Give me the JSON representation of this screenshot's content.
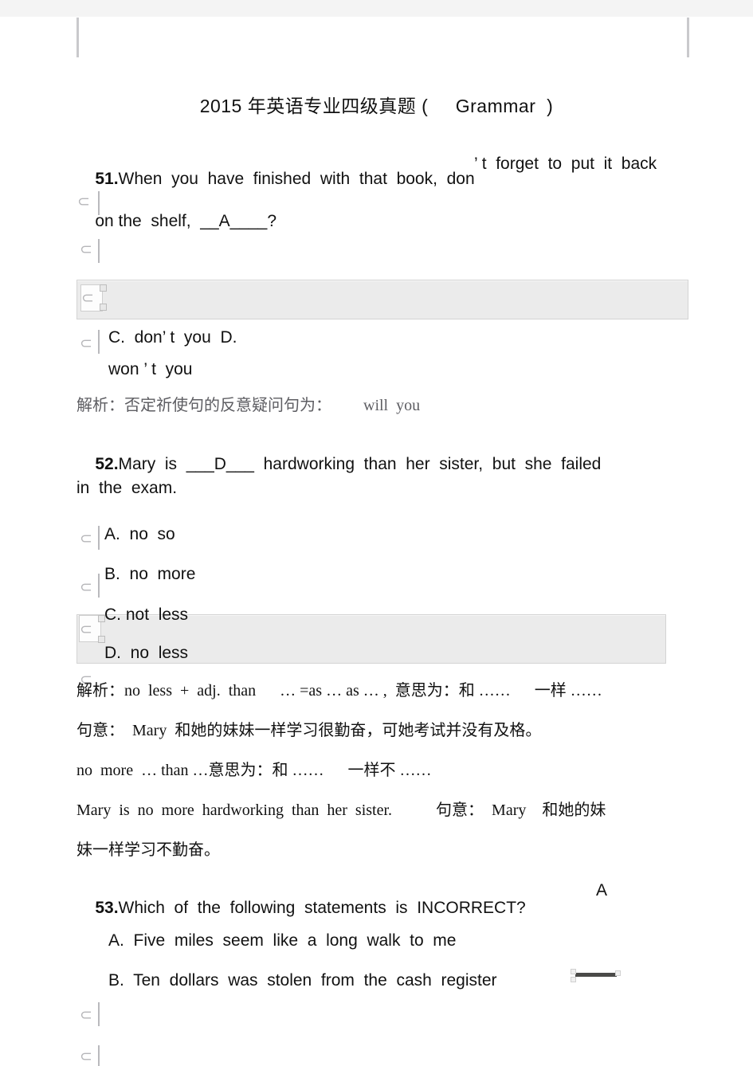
{
  "document": {
    "title": "2015 年英语专业四级真题 (     Grammar  )"
  },
  "questions": [
    {
      "number": "51.",
      "text_line1": "When  you  have  finished  with  that  book,  don",
      "text_line1_right": "’ t  forget  to  put  it  back",
      "text_line2": "on",
      "text_line2_rest": " the  shelf,  __A____?",
      "options": [
        {
          "label": ""
        },
        {
          "label": ""
        },
        {
          "label": "C.  don’ t  you  D."
        },
        {
          "label": "won ’ t  you"
        }
      ],
      "analysis": "解析：否定祈使句的反意疑问句为：        will  you"
    },
    {
      "number": "52.",
      "text_line1": "Mary  is  ___D___  hardworking  than  her  sister,  but  she  failed",
      "text_line2": "in  the  exam.",
      "options": [
        {
          "label": "A.  no  so"
        },
        {
          "label": "B.  no  more"
        },
        {
          "label": "C. not  less"
        },
        {
          "label": "D.  no  less"
        }
      ],
      "analysis_lines": [
        "解析：no  less  +  adj.  than      … =as … as … ,  意思为：和 ……      一样 ……",
        "句意：  Mary  和她的妹妹一样学习很勤奋，可她考试并没有及格。",
        "no  more  … than …意思为：和 ……      一样不 ……",
        "Mary  is  no  more  hardworking  than  her  sister.           句意：  Mary    和她的妹",
        "妹一样学习不勤奋。"
      ]
    },
    {
      "number": "53.",
      "text_line1": "Which  of  the  following  statements  is  INCORRECT?",
      "answer": "A",
      "options": [
        {
          "label": "A.  Five  miles  seem  like  a  long  walk  to  me"
        },
        {
          "label": "B.  Ten  dollars  was  stolen  from  the  cash  register"
        },
        {
          "label": ""
        },
        {
          "label": ""
        }
      ]
    }
  ],
  "colors": {
    "page_background": "#ffffff",
    "top_band": "#f4f4f4",
    "highlight_bar": "#ebebeb",
    "ghost_glyph": "#b6b6b9",
    "text": "#111111",
    "analysis_text": "#5d5d62"
  }
}
